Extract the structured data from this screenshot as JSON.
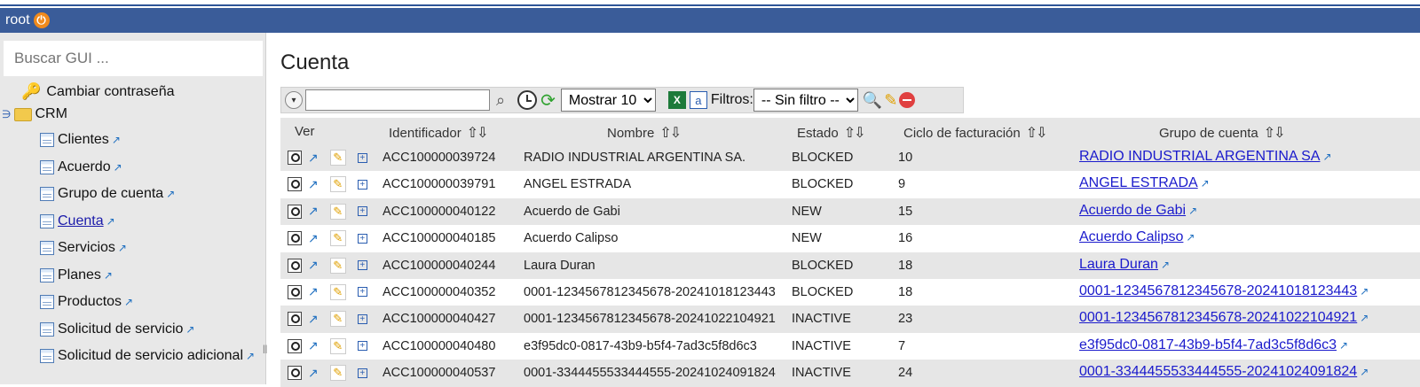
{
  "topbar": {
    "user": "root"
  },
  "sidebar": {
    "search_placeholder": "Buscar GUI ...",
    "change_password": "Cambiar contraseña",
    "folder": "CRM",
    "items": [
      {
        "label": "Clientes",
        "active": false
      },
      {
        "label": "Acuerdo",
        "active": false
      },
      {
        "label": "Grupo de cuenta",
        "active": false
      },
      {
        "label": "Cuenta",
        "active": true
      },
      {
        "label": "Servicios",
        "active": false
      },
      {
        "label": "Planes",
        "active": false
      },
      {
        "label": "Productos",
        "active": false
      },
      {
        "label": "Solicitud de servicio",
        "active": false
      },
      {
        "label": "Solicitud de servicio adicional",
        "active": false
      }
    ]
  },
  "main": {
    "title": "Cuenta",
    "toolbar": {
      "search_value": "",
      "show_select": "Mostrar 10",
      "filters_label": "Filtros:",
      "filter_select": "-- Sin filtro --"
    },
    "columns": {
      "view": "Ver",
      "id": "Identificador",
      "name": "Nombre",
      "state": "Estado",
      "cycle": "Ciclo de facturación",
      "group": "Grupo de cuenta"
    },
    "rows": [
      {
        "id": "ACC100000039724",
        "name": "RADIO INDUSTRIAL ARGENTINA SA.",
        "state": "BLOCKED",
        "cycle": "10",
        "group": "RADIO INDUSTRIAL ARGENTINA SA"
      },
      {
        "id": "ACC100000039791",
        "name": "ANGEL ESTRADA",
        "state": "BLOCKED",
        "cycle": "9",
        "group": "ANGEL ESTRADA"
      },
      {
        "id": "ACC100000040122",
        "name": "Acuerdo de Gabi",
        "state": "NEW",
        "cycle": "15",
        "group": "Acuerdo de Gabi"
      },
      {
        "id": "ACC100000040185",
        "name": "Acuerdo Calipso",
        "state": "NEW",
        "cycle": "16",
        "group": "Acuerdo Calipso"
      },
      {
        "id": "ACC100000040244",
        "name": "Laura Duran",
        "state": "BLOCKED",
        "cycle": "18",
        "group": "Laura Duran"
      },
      {
        "id": "ACC100000040352",
        "name": "0001-1234567812345678-20241018123443",
        "state": "BLOCKED",
        "cycle": "18",
        "group": "0001-1234567812345678-20241018123443"
      },
      {
        "id": "ACC100000040427",
        "name": "0001-1234567812345678-20241022104921",
        "state": "INACTIVE",
        "cycle": "23",
        "group": "0001-1234567812345678-20241022104921"
      },
      {
        "id": "ACC100000040480",
        "name": "e3f95dc0-0817-43b9-b5f4-7ad3c5f8d6c3",
        "state": "INACTIVE",
        "cycle": "7",
        "group": "e3f95dc0-0817-43b9-b5f4-7ad3c5f8d6c3"
      },
      {
        "id": "ACC100000040537",
        "name": "0001-3344455533444555-20241024091824",
        "state": "INACTIVE",
        "cycle": "24",
        "group": "0001-3344455533444555-20241024091824"
      }
    ]
  }
}
